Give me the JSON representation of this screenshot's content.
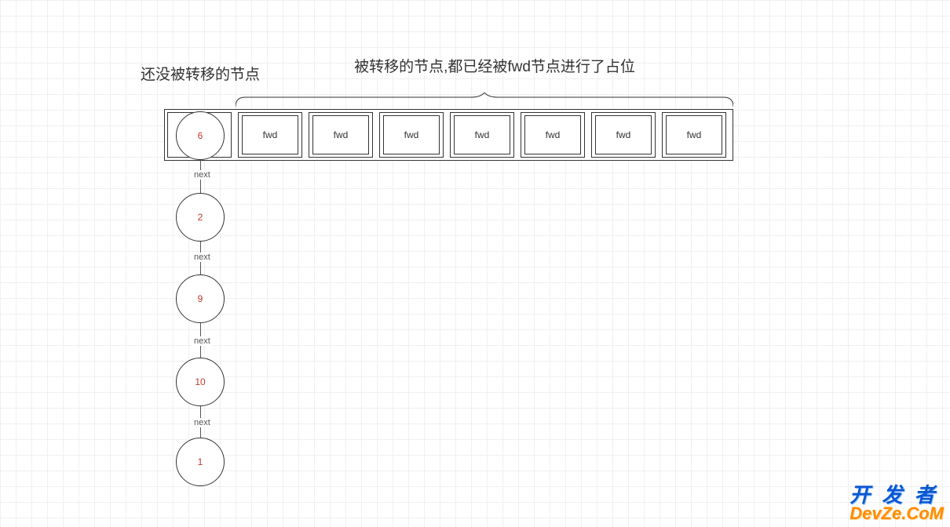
{
  "captions": {
    "left": "还没被转移的节点",
    "right": "被转移的节点,都已经被fwd节点进行了占位"
  },
  "bucket_cells": [
    {
      "type": "node",
      "value": "6"
    },
    {
      "type": "fwd",
      "label": "fwd"
    },
    {
      "type": "fwd",
      "label": "fwd"
    },
    {
      "type": "fwd",
      "label": "fwd"
    },
    {
      "type": "fwd",
      "label": "fwd"
    },
    {
      "type": "fwd",
      "label": "fwd"
    },
    {
      "type": "fwd",
      "label": "fwd"
    },
    {
      "type": "fwd",
      "label": "fwd"
    }
  ],
  "chain": [
    {
      "value": "6"
    },
    {
      "value": "2"
    },
    {
      "value": "9"
    },
    {
      "value": "10"
    },
    {
      "value": "1"
    }
  ],
  "edge_label": "next",
  "watermark": {
    "cn": "开 发 者",
    "en": "DevZe.CoM"
  }
}
